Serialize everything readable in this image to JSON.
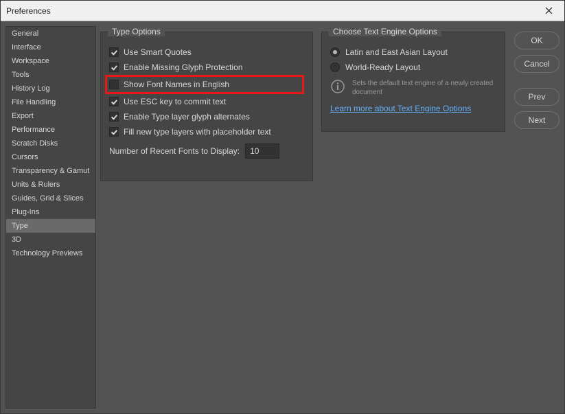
{
  "window": {
    "title": "Preferences"
  },
  "sidebar": {
    "items": [
      "General",
      "Interface",
      "Workspace",
      "Tools",
      "History Log",
      "File Handling",
      "Export",
      "Performance",
      "Scratch Disks",
      "Cursors",
      "Transparency & Gamut",
      "Units & Rulers",
      "Guides, Grid & Slices",
      "Plug-Ins",
      "Type",
      "3D",
      "Technology Previews"
    ],
    "selectedIndex": 14
  },
  "typeOptions": {
    "title": "Type Options",
    "checks": [
      {
        "label": "Use Smart Quotes",
        "checked": true,
        "hl": false
      },
      {
        "label": "Enable Missing Glyph Protection",
        "checked": true,
        "hl": false
      },
      {
        "label": "Show Font Names in English",
        "checked": false,
        "hl": true
      },
      {
        "label": "Use ESC key to commit text",
        "checked": true,
        "hl": false
      },
      {
        "label": "Enable Type layer glyph alternates",
        "checked": true,
        "hl": false
      },
      {
        "label": "Fill new type layers with placeholder text",
        "checked": true,
        "hl": false
      }
    ],
    "recentLabel": "Number of Recent Fonts to Display:",
    "recentValue": "10"
  },
  "textEngine": {
    "title": "Choose Text Engine Options",
    "radios": [
      {
        "label": "Latin and East Asian Layout",
        "on": true
      },
      {
        "label": "World-Ready Layout",
        "on": false
      }
    ],
    "info": "Sets the default text engine of a newly created document",
    "link": "Learn more about Text Engine Options"
  },
  "buttons": {
    "ok": "OK",
    "cancel": "Cancel",
    "prev": "Prev",
    "next": "Next"
  }
}
